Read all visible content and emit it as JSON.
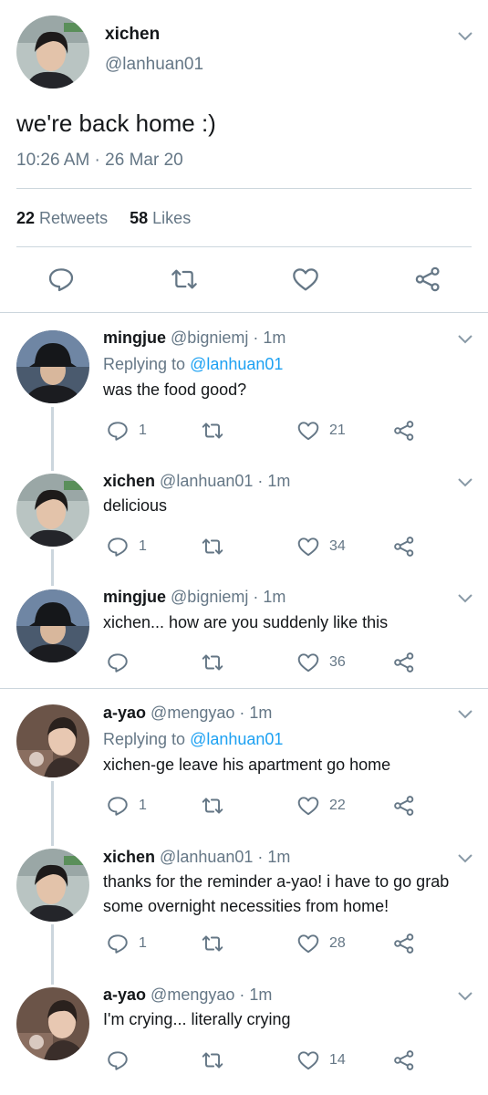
{
  "main_tweet": {
    "name": "xichen",
    "handle": "@lanhuan01",
    "text": "we're back home :)",
    "timestamp": "10:26 AM · 26 Mar 20",
    "retweets_count": "22",
    "retweets_label": "Retweets",
    "likes_count": "58",
    "likes_label": "Likes"
  },
  "replies": [
    {
      "name": "mingjue",
      "meta": "@bigniemj · 1m",
      "replying_label": "Replying to",
      "replying_to": "@lanhuan01",
      "text": "was the food good?",
      "reply_count": "1",
      "retweet_count": "",
      "like_count": "21"
    },
    {
      "name": "xichen",
      "meta": "@lanhuan01 · 1m",
      "text": "delicious",
      "reply_count": "1",
      "retweet_count": "",
      "like_count": "34"
    },
    {
      "name": "mingjue",
      "meta": "@bigniemj · 1m",
      "text": "xichen... how are you suddenly like this",
      "reply_count": "",
      "retweet_count": "",
      "like_count": "36"
    },
    {
      "name": "a-yao",
      "meta": "@mengyao · 1m",
      "replying_label": "Replying to",
      "replying_to": "@lanhuan01",
      "text": "xichen-ge leave his apartment go home",
      "reply_count": "1",
      "retweet_count": "",
      "like_count": "22"
    },
    {
      "name": "xichen",
      "meta": "@lanhuan01 · 1m",
      "text": "thanks for the reminder a-yao! i have to go grab some overnight necessities from home!",
      "reply_count": "1",
      "retweet_count": "",
      "like_count": "28"
    },
    {
      "name": "a-yao",
      "meta": "@mengyao · 1m",
      "text": "I'm crying... literally crying",
      "reply_count": "",
      "retweet_count": "",
      "like_count": "14"
    }
  ],
  "icons": {
    "reply": "reply-icon",
    "retweet": "retweet-icon",
    "like": "heart-icon",
    "share": "share-icon",
    "menu": "chevron-down-icon"
  },
  "colors": {
    "link": "#1da1f2",
    "muted": "#657786",
    "divider": "#ccd6dd",
    "text": "#14171a"
  }
}
